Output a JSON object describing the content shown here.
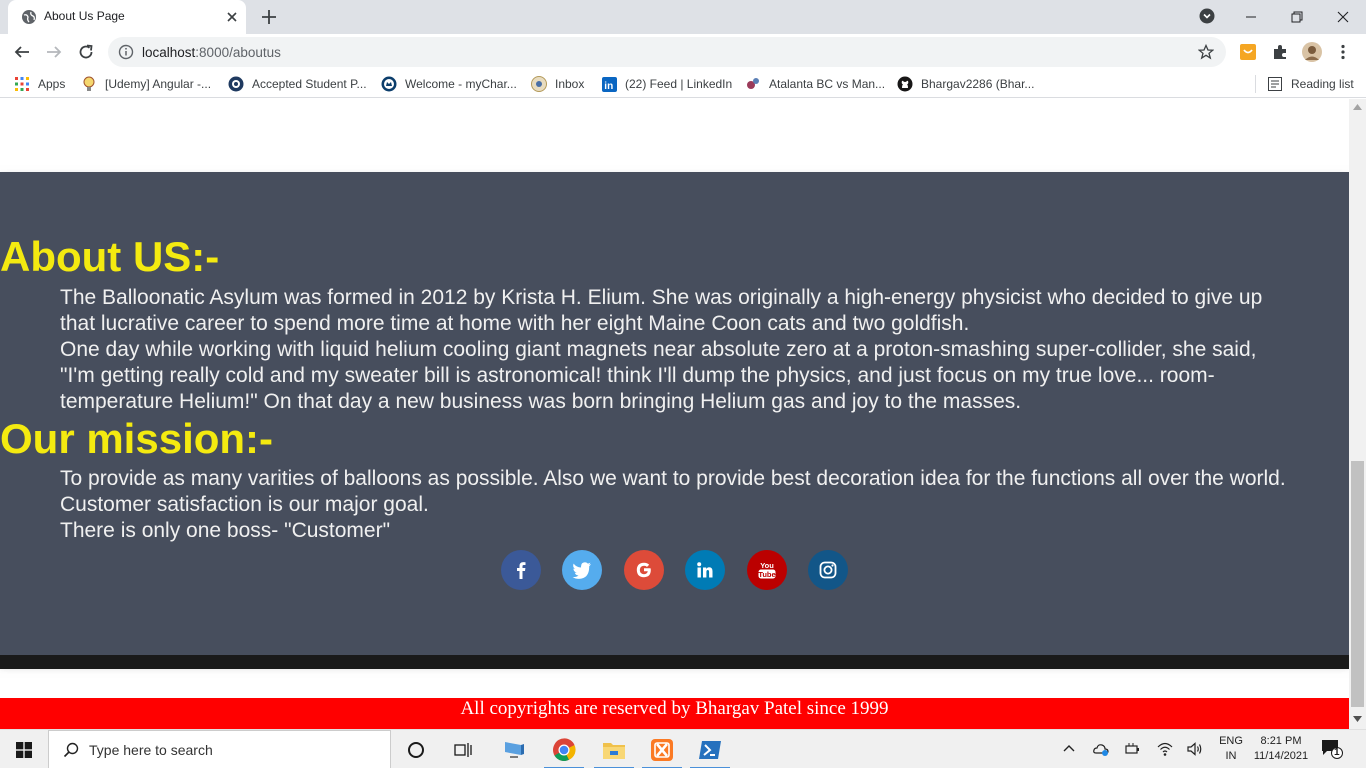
{
  "browser": {
    "tab_title": "About Us Page",
    "url_host": "localhost",
    "url_path": ":8000/aboutus",
    "bookmarks": [
      {
        "label": "Apps",
        "icon": "apps-grid-icon"
      },
      {
        "label": "[Udemy] Angular -...",
        "icon": "udemy-bulb-icon"
      },
      {
        "label": "Accepted Student P...",
        "icon": "university-seal-icon"
      },
      {
        "label": "Welcome - myChar...",
        "icon": "charlotte-crown-icon"
      },
      {
        "label": "Inbox",
        "icon": "mail-seal-icon"
      },
      {
        "label": "(22) Feed | LinkedIn",
        "icon": "linkedin-icon"
      },
      {
        "label": "Atalanta BC vs Man...",
        "icon": "soccer-icon"
      },
      {
        "label": "Bhargav2286 (Bhar...",
        "icon": "github-icon"
      }
    ],
    "reading_list": "Reading list"
  },
  "page": {
    "about_heading": "About US:-",
    "about_paragraph_1": "The Balloonatic Asylum was formed in 2012 by Krista H. Elium. She was originally a high-energy physicist who decided to give up that lucrative career to spend more time at home with her eight Maine Coon cats and two goldfish.",
    "about_paragraph_2": "One day while working with liquid helium cooling giant magnets near absolute zero at a proton-smashing super-collider, she said, \"I'm getting really cold and my sweater bill is astronomical! think I'll dump the physics, and just focus on my true love... room-temperature Helium!\" On that day a new business was born bringing Helium gas and joy to the masses.",
    "mission_heading": "Our mission:-",
    "mission_line_1": "To provide as many varities of balloons as possible. Also we want to provide best decoration idea for the functions all over the world.",
    "mission_line_2": "Customer satisfaction is our major goal.",
    "mission_line_3": "There is only one boss- \"Customer\"",
    "social_links": [
      {
        "name": "facebook",
        "icon": "facebook-icon",
        "color": "#3b5998"
      },
      {
        "name": "twitter",
        "icon": "twitter-icon",
        "color": "#55acee"
      },
      {
        "name": "google",
        "icon": "google-icon",
        "color": "#dd4b39"
      },
      {
        "name": "linkedin",
        "icon": "linkedin-icon",
        "color": "#007bb5"
      },
      {
        "name": "youtube",
        "icon": "youtube-icon",
        "color": "#bb0000"
      },
      {
        "name": "instagram",
        "icon": "instagram-icon",
        "color": "#125688"
      }
    ],
    "footer_text": "All copyrights are reserved by Bhargav Patel since 1999",
    "colors": {
      "section_bg": "#474e5d",
      "heading": "#f4ea10",
      "footer_bg": "#ff0000"
    }
  },
  "taskbar": {
    "search_placeholder": "Type here to search",
    "language": "ENG",
    "region": "IN",
    "time": "8:21 PM",
    "date": "11/14/2021",
    "notification_count": "1"
  }
}
